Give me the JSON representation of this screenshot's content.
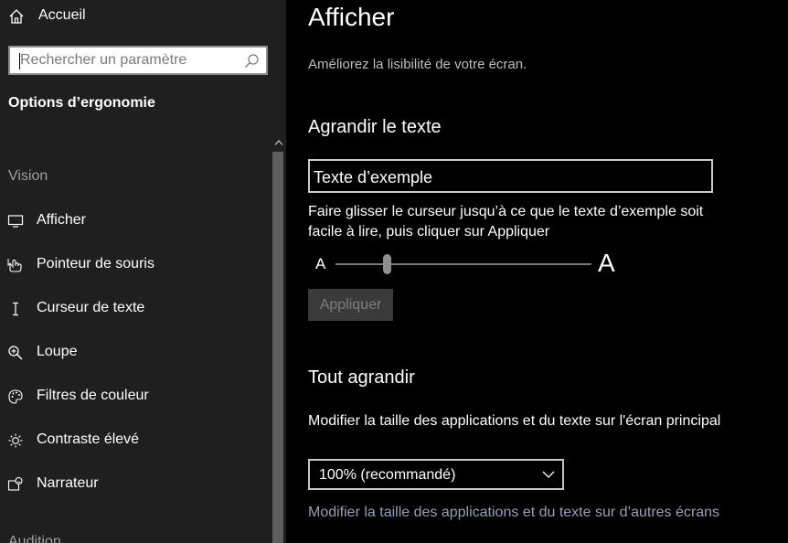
{
  "sidebar": {
    "home_label": "Accueil",
    "search_placeholder": "Rechercher un paramètre",
    "section_title": "Options d’ergonomie",
    "group_vision": "Vision",
    "items": [
      {
        "label": "Afficher",
        "icon": "monitor-icon"
      },
      {
        "label": "Pointeur de souris",
        "icon": "mouse-pointer-icon"
      },
      {
        "label": "Curseur de texte",
        "icon": "text-cursor-icon"
      },
      {
        "label": "Loupe",
        "icon": "magnifier-icon"
      },
      {
        "label": "Filtres de couleur",
        "icon": "palette-icon"
      },
      {
        "label": "Contraste élevé",
        "icon": "brightness-icon"
      },
      {
        "label": "Narrateur",
        "icon": "narrator-icon"
      }
    ],
    "group_audition": "Audition"
  },
  "main": {
    "title": "Afficher",
    "subtitle": "Améliorez la lisibilité de votre écran.",
    "enlarge_text": {
      "heading": "Agrandir le texte",
      "sample": "Texte d’exemple",
      "description": "Faire glisser le curseur jusqu’à ce que le texte d’exemple soit facile à lire, puis cliquer sur Appliquer",
      "slider_min_label": "A",
      "slider_max_label": "A",
      "slider_level": 0.2,
      "apply_label": "Appliquer"
    },
    "enlarge_all": {
      "heading": "Tout agrandir",
      "description": "Modifier la taille des applications et du texte sur l'écran principal",
      "dropdown_value": "100% (recommandé)",
      "link": "Modifier la taille des applications et du texte sur d’autres écrans"
    }
  },
  "colors": {
    "sidebar_bg": "#1f1f1f",
    "main_bg": "#000000",
    "link": "#9a9fb3"
  }
}
